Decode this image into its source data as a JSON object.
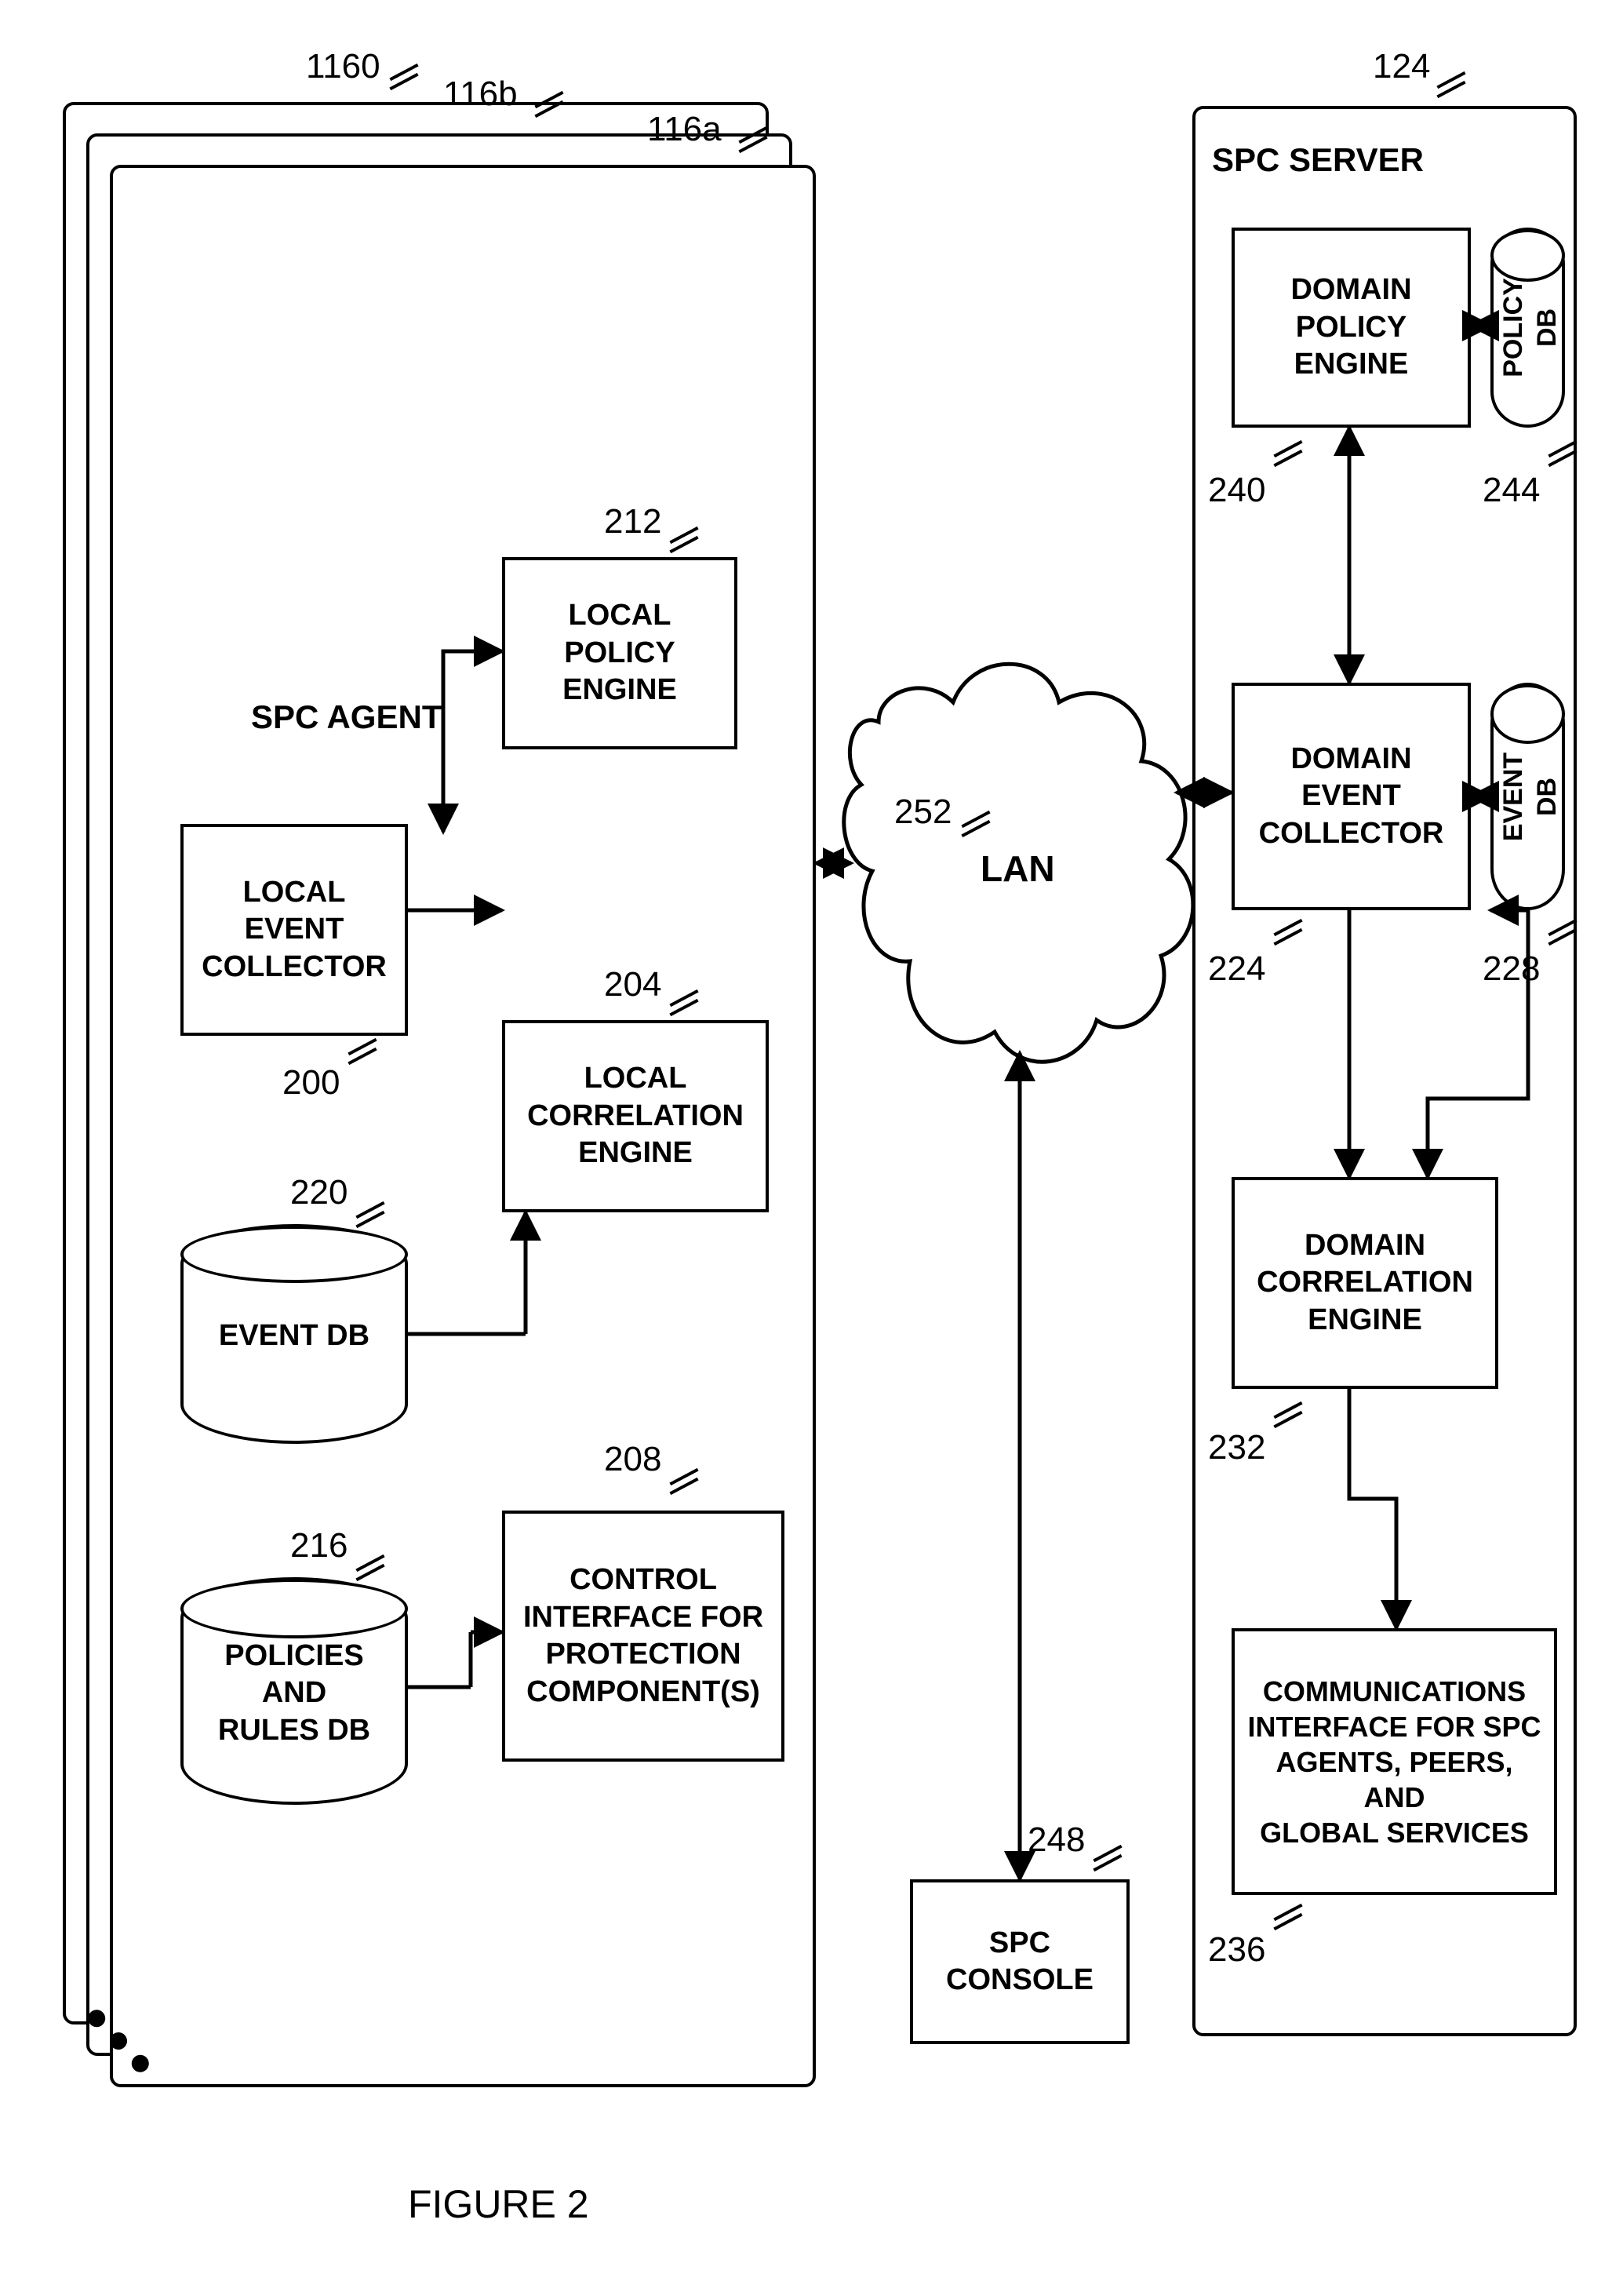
{
  "figure_caption": "FIGURE 2",
  "agent": {
    "stack_ref_a": "1160",
    "stack_ref_b": "116b",
    "stack_ref_c": "116a",
    "title": "SPC AGENT",
    "local_event_collector": {
      "label": "LOCAL\nEVENT\nCOLLECTOR",
      "ref": "200"
    },
    "local_policy_engine": {
      "label": "LOCAL\nPOLICY\nENGINE",
      "ref": "212"
    },
    "local_correlation_engine": {
      "label": "LOCAL\nCORRELATION\nENGINE",
      "ref": "204"
    },
    "control_interface": {
      "label": "CONTROL\nINTERFACE FOR\nPROTECTION\nCOMPONENT(S)",
      "ref": "208"
    },
    "event_db": {
      "label": "EVENT DB",
      "ref": "220"
    },
    "policies_rules_db": {
      "label": "POLICIES\nAND\nRULES DB",
      "ref": "216"
    }
  },
  "lan": {
    "label": "LAN",
    "ref": "252"
  },
  "console": {
    "label": "SPC\nCONSOLE",
    "ref": "248"
  },
  "server": {
    "title": "SPC SERVER",
    "ref": "124",
    "domain_policy_engine": {
      "label": "DOMAIN\nPOLICY\nENGINE",
      "ref": "240"
    },
    "domain_event_collector": {
      "label": "DOMAIN\nEVENT\nCOLLECTOR",
      "ref": "224"
    },
    "domain_correlation_engine": {
      "label": "DOMAIN\nCORRELATION\nENGINE",
      "ref": "232"
    },
    "comm_interface": {
      "label": "COMMUNICATIONS\nINTERFACE FOR SPC\nAGENTS, PEERS, AND\nGLOBAL SERVICES",
      "ref": "236"
    },
    "policy_db": {
      "label": "POLICY\nDB",
      "ref": "244"
    },
    "event_db": {
      "label": "EVENT\nDB",
      "ref": "228"
    }
  }
}
